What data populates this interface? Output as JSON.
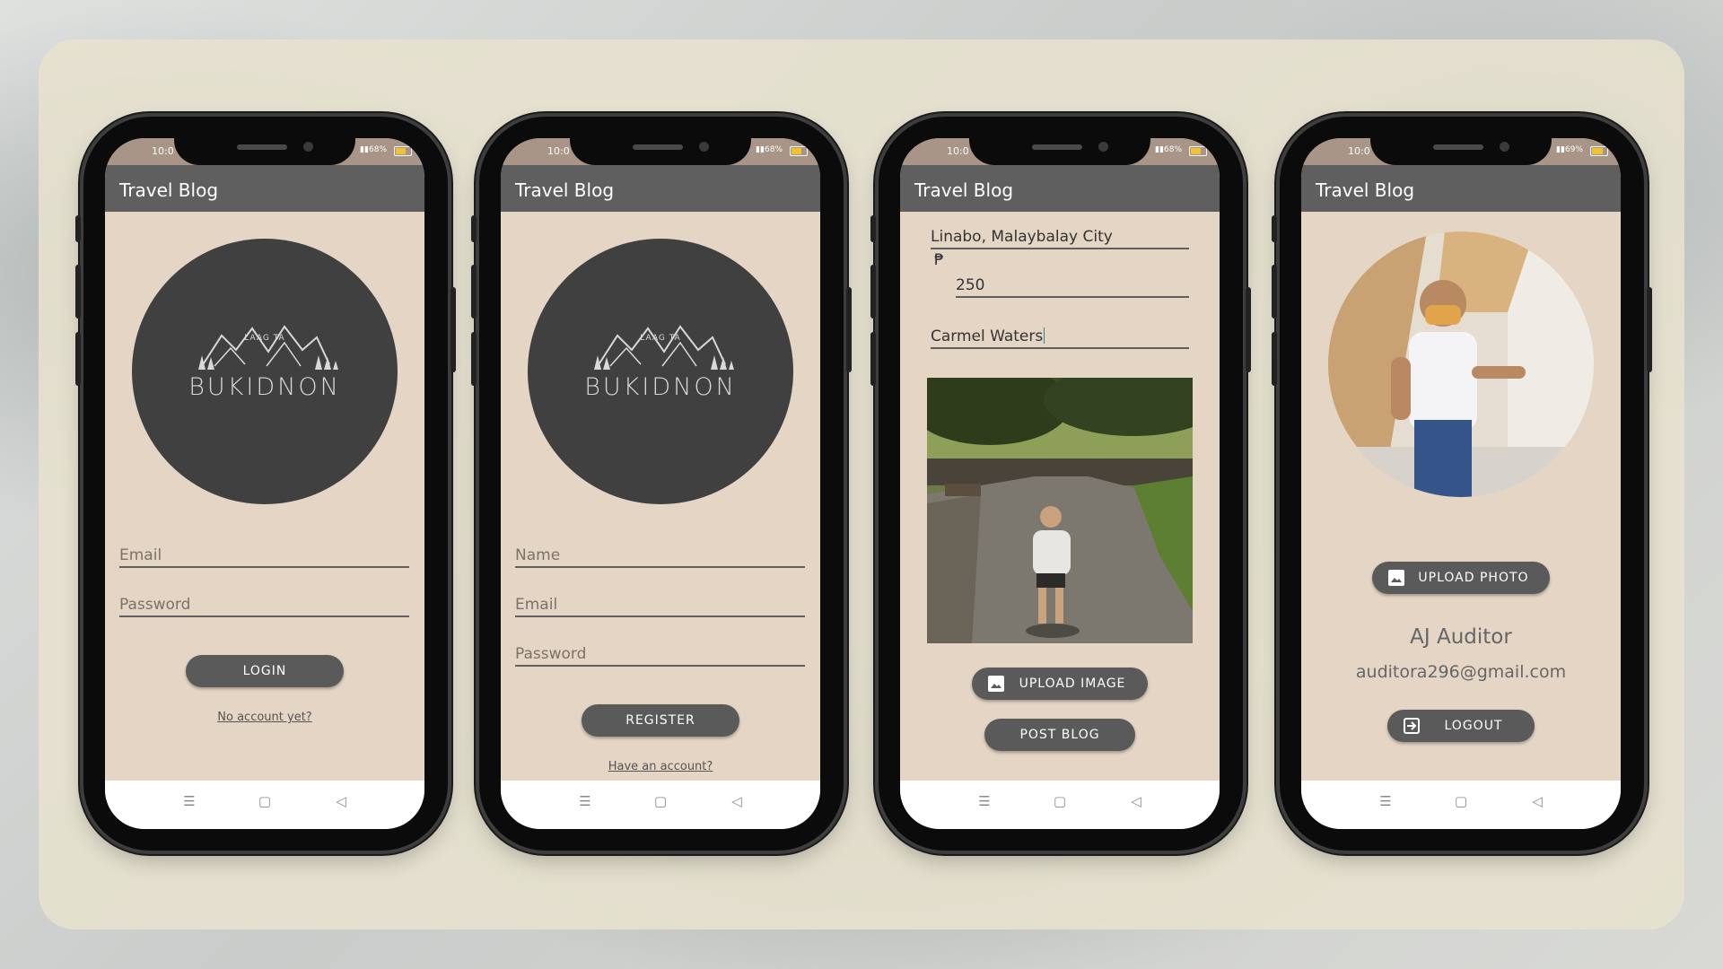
{
  "phones": [
    {
      "status": {
        "time": "10:0",
        "battery": "68%"
      },
      "appbar_title": "Travel Blog",
      "logo": {
        "small": "LAAG TA",
        "big": "BUKIDNON"
      },
      "fields": [
        {
          "placeholder": "Email"
        },
        {
          "placeholder": "Password"
        }
      ],
      "button": "LOGIN",
      "link": "No account yet?"
    },
    {
      "status": {
        "time": "10:0",
        "battery": "68%"
      },
      "appbar_title": "Travel Blog",
      "logo": {
        "small": "LAAG TA",
        "big": "BUKIDNON"
      },
      "fields": [
        {
          "placeholder": "Name"
        },
        {
          "placeholder": "Email"
        },
        {
          "placeholder": "Password"
        }
      ],
      "button": "REGISTER",
      "link": "Have an account?"
    },
    {
      "status": {
        "time": "10:0",
        "battery": "68%"
      },
      "appbar_title": "Travel Blog",
      "location": "Linabo, Malaybalay City",
      "price_symbol": "₱",
      "price": "250",
      "place": "Carmel Waters",
      "upload_button": "UPLOAD IMAGE",
      "post_button": "POST BLOG"
    },
    {
      "status": {
        "time": "10:0",
        "battery": "69%"
      },
      "appbar_title": "Travel Blog",
      "upload_button": "UPLOAD PHOTO",
      "user_name": "AJ Auditor",
      "user_email": "auditora296@gmail.com",
      "logout_button": "LOGOUT"
    }
  ],
  "nav_icons": [
    "menu-icon",
    "home-icon",
    "back-icon"
  ],
  "colors": {
    "appbar": "#5f5f5f",
    "screen_bg": "#e4d5c5",
    "button": "#5a5a5a",
    "logo_circle": "#404040"
  }
}
